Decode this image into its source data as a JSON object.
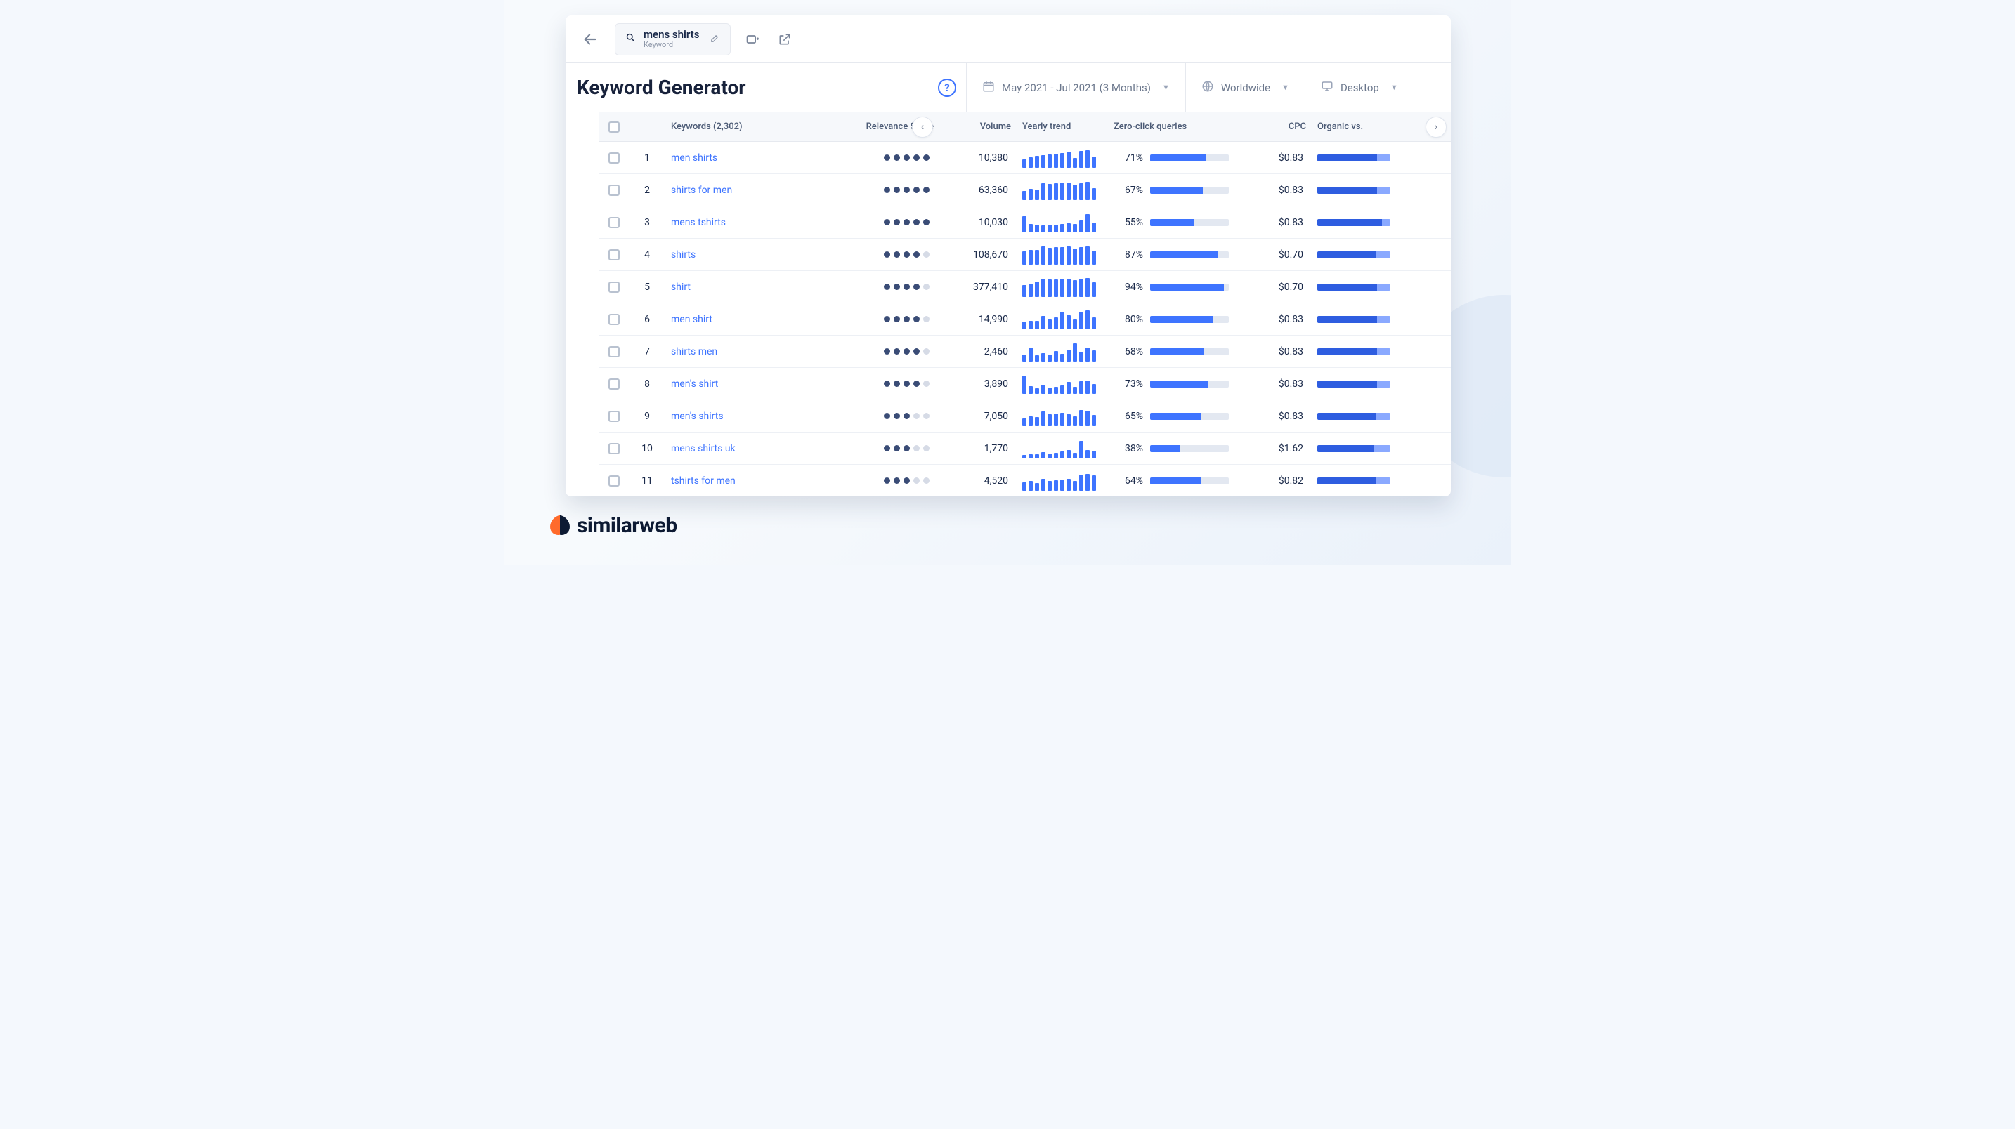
{
  "brand": "similarweb",
  "search": {
    "term": "mens shirts",
    "sublabel": "Keyword"
  },
  "page_title": "Keyword Generator",
  "filters": {
    "date": "May 2021 - Jul 2021 (3 Months)",
    "region": "Worldwide",
    "device": "Desktop"
  },
  "table": {
    "total_keywords_count": "2,302",
    "headers": {
      "keywords": "Keywords",
      "relevance": "Relevance Score",
      "volume": "Volume",
      "trend": "Yearly trend",
      "zero_click": "Zero-click queries",
      "cpc": "CPC",
      "organic": "Organic vs."
    },
    "rows": [
      {
        "idx": 1,
        "keyword": "men shirts",
        "relevance": 5,
        "volume": "10,380",
        "trend": [
          40,
          52,
          58,
          62,
          66,
          70,
          74,
          80,
          50,
          84,
          88,
          56
        ],
        "zero_click_pct": 71,
        "cpc": "$0.83",
        "organic": 82
      },
      {
        "idx": 2,
        "keyword": "shirts for men",
        "relevance": 5,
        "volume": "63,360",
        "trend": [
          44,
          56,
          52,
          84,
          80,
          84,
          86,
          88,
          78,
          84,
          90,
          60
        ],
        "zero_click_pct": 67,
        "cpc": "$0.83",
        "organic": 82
      },
      {
        "idx": 3,
        "keyword": "mens tshirts",
        "relevance": 5,
        "volume": "10,030",
        "trend": [
          82,
          40,
          36,
          34,
          36,
          38,
          40,
          44,
          42,
          60,
          92,
          48
        ],
        "zero_click_pct": 55,
        "cpc": "$0.83",
        "organic": 88
      },
      {
        "idx": 4,
        "keyword": "shirts",
        "relevance": 4,
        "volume": "108,670",
        "trend": [
          66,
          72,
          74,
          90,
          84,
          86,
          88,
          90,
          82,
          88,
          92,
          70
        ],
        "zero_click_pct": 87,
        "cpc": "$0.70",
        "organic": 80
      },
      {
        "idx": 5,
        "keyword": "shirt",
        "relevance": 4,
        "volume": "377,410",
        "trend": [
          60,
          66,
          78,
          92,
          86,
          88,
          90,
          92,
          84,
          90,
          94,
          74
        ],
        "zero_click_pct": 94,
        "cpc": "$0.70",
        "organic": 82
      },
      {
        "idx": 6,
        "keyword": "men shirt",
        "relevance": 4,
        "volume": "14,990",
        "trend": [
          36,
          40,
          42,
          66,
          48,
          60,
          86,
          70,
          50,
          88,
          94,
          60
        ],
        "zero_click_pct": 80,
        "cpc": "$0.83",
        "organic": 82
      },
      {
        "idx": 7,
        "keyword": "shirts men",
        "relevance": 4,
        "volume": "2,460",
        "trend": [
          34,
          68,
          30,
          42,
          34,
          52,
          38,
          58,
          90,
          48,
          70,
          56
        ],
        "zero_click_pct": 68,
        "cpc": "$0.83",
        "organic": 82
      },
      {
        "idx": 8,
        "keyword": "men's shirt",
        "relevance": 4,
        "volume": "3,890",
        "trend": [
          92,
          38,
          28,
          44,
          32,
          34,
          40,
          58,
          34,
          62,
          66,
          48
        ],
        "zero_click_pct": 73,
        "cpc": "$0.83",
        "organic": 82
      },
      {
        "idx": 9,
        "keyword": "men's shirts",
        "relevance": 3,
        "volume": "7,050",
        "trend": [
          36,
          50,
          44,
          72,
          58,
          62,
          66,
          60,
          50,
          82,
          78,
          54
        ],
        "zero_click_pct": 65,
        "cpc": "$0.83",
        "organic": 80
      },
      {
        "idx": 10,
        "keyword": "mens shirts uk",
        "relevance": 3,
        "volume": "1,770",
        "trend": [
          16,
          18,
          20,
          30,
          24,
          28,
          34,
          40,
          26,
          86,
          42,
          36
        ],
        "zero_click_pct": 38,
        "cpc": "$1.62",
        "organic": 78
      },
      {
        "idx": 11,
        "keyword": "tshirts for men",
        "relevance": 3,
        "volume": "4,520",
        "trend": [
          40,
          48,
          36,
          60,
          48,
          52,
          56,
          58,
          50,
          80,
          84,
          78
        ],
        "zero_click_pct": 64,
        "cpc": "$0.82",
        "organic": 80
      }
    ]
  },
  "chart_data": {
    "type": "table",
    "title": "Keyword Generator — mens shirts",
    "columns": [
      "Keyword",
      "Relevance(1-5)",
      "Volume",
      "Zero-click %",
      "CPC",
      "Organic %"
    ],
    "rows": [
      [
        "men shirts",
        5,
        10380,
        71,
        0.83,
        82
      ],
      [
        "shirts for men",
        5,
        63360,
        67,
        0.83,
        82
      ],
      [
        "mens tshirts",
        5,
        10030,
        55,
        0.83,
        88
      ],
      [
        "shirts",
        4,
        108670,
        87,
        0.7,
        80
      ],
      [
        "shirt",
        4,
        377410,
        94,
        0.7,
        82
      ],
      [
        "men shirt",
        4,
        14990,
        80,
        0.83,
        82
      ],
      [
        "shirts men",
        4,
        2460,
        68,
        0.83,
        82
      ],
      [
        "men's shirt",
        4,
        3890,
        73,
        0.83,
        82
      ],
      [
        "men's shirts",
        3,
        7050,
        65,
        0.83,
        80
      ],
      [
        "mens shirts uk",
        3,
        1770,
        38,
        1.62,
        78
      ],
      [
        "tshirts for men",
        3,
        4520,
        64,
        0.82,
        80
      ]
    ]
  }
}
